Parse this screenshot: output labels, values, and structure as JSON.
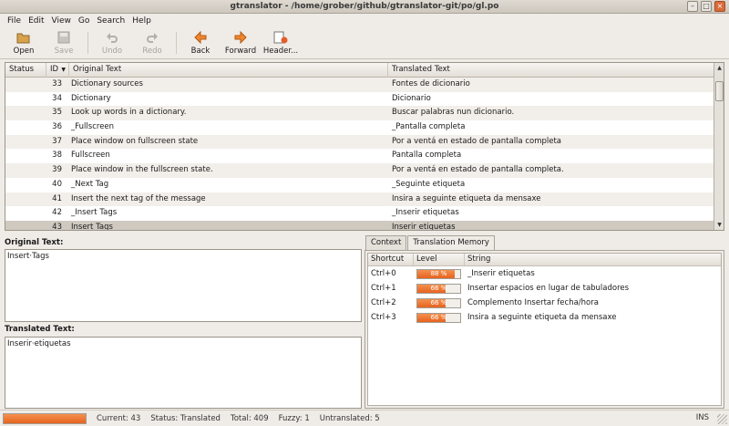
{
  "window": {
    "title": "gtranslator - /home/grober/github/gtranslator-git/po/gl.po"
  },
  "menu": [
    "File",
    "Edit",
    "View",
    "Go",
    "Search",
    "Help"
  ],
  "toolbar": {
    "open": "Open",
    "save": "Save",
    "undo": "Undo",
    "redo": "Redo",
    "back": "Back",
    "forward": "Forward",
    "header": "Header..."
  },
  "table": {
    "headers": [
      "Status",
      "ID",
      "Original Text",
      "Translated Text"
    ],
    "rows": [
      {
        "id": "33",
        "orig": "Dictionary sources",
        "trans": "Fontes de dicionario"
      },
      {
        "id": "34",
        "orig": "Dictionary",
        "trans": "Dicionario"
      },
      {
        "id": "35",
        "orig": "Look up words in a dictionary.",
        "trans": "Buscar palabras nun dicionario."
      },
      {
        "id": "36",
        "orig": "_Fullscreen",
        "trans": "_Pantalla completa"
      },
      {
        "id": "37",
        "orig": "Place window on fullscreen state",
        "trans": "Por a ventá en estado de pantalla completa"
      },
      {
        "id": "38",
        "orig": "Fullscreen",
        "trans": "Pantalla completa"
      },
      {
        "id": "39",
        "orig": "Place window in the fullscreen state.",
        "trans": "Por a ventá en estado de pantalla completa."
      },
      {
        "id": "40",
        "orig": "_Next Tag",
        "trans": "_Seguinte etiqueta"
      },
      {
        "id": "41",
        "orig": "Insert the next tag of the message",
        "trans": "Insira a seguinte etiqueta da mensaxe"
      },
      {
        "id": "42",
        "orig": "_Insert Tags",
        "trans": "_Inserir etiquetas"
      },
      {
        "id": "43",
        "orig": "Insert Tags",
        "trans": "Inserir etiquetas"
      }
    ]
  },
  "original": {
    "label": "Original Text:",
    "value": "Insert·Tags"
  },
  "translated": {
    "label": "Translated Text:",
    "value": "Inserir·etiquetas"
  },
  "tabs": [
    "Context",
    "Translation Memory"
  ],
  "tm": {
    "headers": [
      "Shortcut",
      "Level",
      "String"
    ],
    "rows": [
      {
        "shortcut": "Ctrl+0",
        "level": 88,
        "level_text": "88 %",
        "string": "_Inserir etiquetas"
      },
      {
        "shortcut": "Ctrl+1",
        "level": 66,
        "level_text": "66 %",
        "string": "Insertar espacios en lugar de tabuladores"
      },
      {
        "shortcut": "Ctrl+2",
        "level": 66,
        "level_text": "66 %",
        "string": "Complemento Insertar fecha/hora"
      },
      {
        "shortcut": "Ctrl+3",
        "level": 66,
        "level_text": "66 %",
        "string": "Insira a seguinte etiqueta da mensaxe"
      }
    ]
  },
  "status": {
    "progress": 1.0,
    "current": "Current: 43",
    "state": "Status: Translated",
    "total": "Total: 409",
    "fuzzy": "Fuzzy: 1",
    "untranslated": "Untranslated: 5",
    "mode": "INS"
  },
  "colors": {
    "accent": "#e5641f",
    "selected_row": "#cfc9c0"
  }
}
